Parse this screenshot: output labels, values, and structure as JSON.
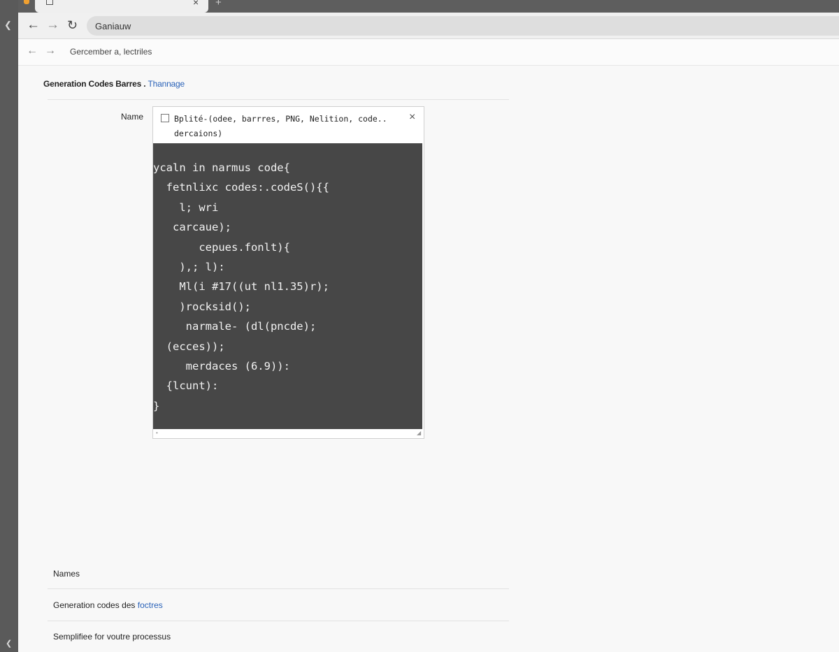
{
  "browser": {
    "tab": {
      "close_glyph": "×",
      "newtab_glyph": "+"
    },
    "address_bar": {
      "value": "Ganiauw"
    },
    "subnav": {
      "title": "Gercember a, lectriles"
    }
  },
  "page": {
    "heading": {
      "text": "Generation Codes Barres .",
      "link": "Thannage"
    },
    "name_label": "Name",
    "file_panel": {
      "title": "Bplité-(odee, barrres, PNG, Nelition, code.. dercaions)",
      "close_glyph": "×",
      "code_lines": [
        "ycaln in narmus code{",
        "  fetnlixc codes:.codeS(){{",
        "    l; wri",
        "   carcaue);",
        "       cepues.fonlt){",
        "    ),; l):",
        "    Ml(i #17((ut nl1.35)r);",
        "    )rocksid();",
        "     narmale- (dl(pncde);",
        "  (ecces));",
        "     merdaces (6.9)):",
        "  {lcunt):",
        "}"
      ]
    },
    "list": [
      {
        "text": "Names",
        "link": ""
      },
      {
        "text": "Generation codes des ",
        "link": "foctres"
      },
      {
        "text": "Semplifiee for voutre processus",
        "link": ""
      }
    ]
  },
  "icons": {
    "back": "←",
    "forward": "→",
    "reload": "↻",
    "close": "×",
    "side_arrow": "◆"
  }
}
